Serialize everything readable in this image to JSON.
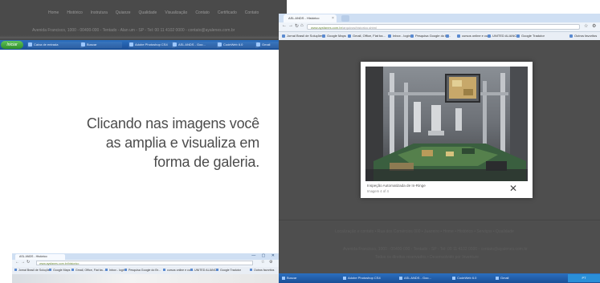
{
  "site": {
    "nav": [
      "Home",
      "Histórico",
      "Instrutura",
      "Quianze",
      "Qualidade",
      "Visualização",
      "Contato",
      "Certificado",
      "Contato"
    ],
    "address": "Avenida Francisco, 1000 - 00400-000 - Tentado - Alan um - SP - Tel: 00 11 4102 0000 - contato@ayalenes.com.br"
  },
  "taskbar_left": {
    "start": "Iniciar",
    "items": [
      "Caixa de entrada",
      "Buscar",
      "Adobe Photoshop CS4",
      "ASL ANDS - Goo...",
      "CodeWeb 6.0",
      "Gmail"
    ]
  },
  "caption": {
    "line1": "Clicando nas imagens você",
    "line2": "as amplia e visualiza em",
    "line3": "forma de galeria."
  },
  "browser": {
    "tab_title": "ASL ANDS - Histórico",
    "url_host": "www.aysfanes.com.br",
    "url_path": "/arquivos/historico.shtml",
    "bookmarks": [
      "Jornal Brasil de Soluções",
      "Google Maps",
      "Gmail, Office, Fiat ba...",
      "Inbox - login",
      "Pesquisa Google do Br...",
      "",
      "cursos online e cur...",
      "UNITED ALIANCE",
      "Google Tradutor",
      "Outros favoritos"
    ],
    "ghost_lines": [
      "Localização e contato • Rua dos Comércios 000 • Juazeiro • Home • Histórico • Serviços • Qualidade",
      "Avenida Francisco, 1000 - 00400-000 - Tentado - SP - Tel: 00 11 4102 0000 - contato@ayalenes.com.br",
      "Todos os direitos reservados • Desenvolvido por Inventure"
    ]
  },
  "lightbox": {
    "title": "Inspeção Automatizada de In-Ringe",
    "subtitle": "Imagem 4 of 4",
    "close": "✕"
  },
  "taskbar_right": {
    "items": [
      "Buscar",
      "Adobe Photoshop CS4",
      "ASL ANDS - Goo...",
      "CodeWeb 6.0",
      "Gmail"
    ],
    "tray": "PT"
  },
  "browser2": {
    "tab_title": "ASL ANDS - Histórico",
    "winbtns": "— ▢ ✕",
    "url": "www.aysfanes.com.br/historico",
    "bookmarks": [
      "Jornal Brasil de Soluções",
      "Google Maps",
      "Gmail, Office, Fiat ba...",
      "Inbox - login",
      "Pesquisa Google do Br...",
      "cursos online e cur...",
      "UNITED ALIANCE",
      "Google Tradutor",
      "Outros favoritos"
    ]
  },
  "colors": {
    "taskbar": "#1b4f96",
    "caption": "#4c4c4c",
    "overlay": "#4e4e4e"
  }
}
